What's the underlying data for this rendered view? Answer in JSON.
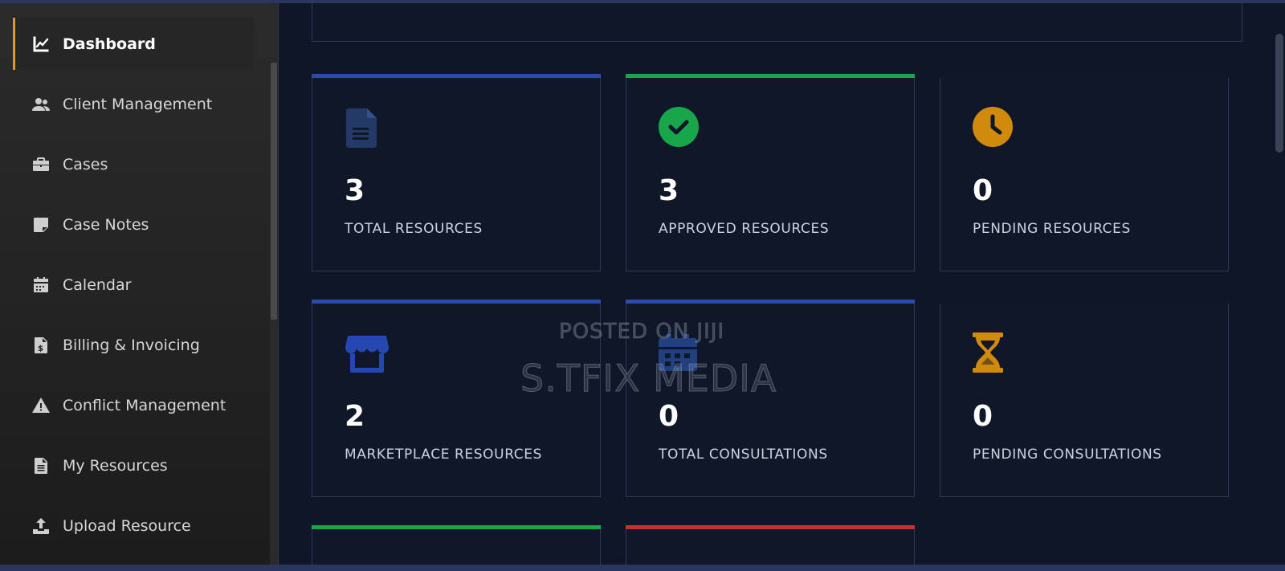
{
  "sidebar": {
    "items": [
      {
        "label": "Dashboard",
        "icon": "chart-line-icon",
        "active": true
      },
      {
        "label": "Client Management",
        "icon": "users-icon"
      },
      {
        "label": "Cases",
        "icon": "briefcase-icon"
      },
      {
        "label": "Case Notes",
        "icon": "sticky-note-icon"
      },
      {
        "label": "Calendar",
        "icon": "calendar-icon"
      },
      {
        "label": "Billing & Invoicing",
        "icon": "invoice-dollar-icon"
      },
      {
        "label": "Conflict Management",
        "icon": "warning-icon"
      },
      {
        "label": "My Resources",
        "icon": "file-lines-icon"
      },
      {
        "label": "Upload Resource",
        "icon": "upload-icon"
      }
    ]
  },
  "stats": [
    {
      "count": "3",
      "label": "TOTAL RESOURCES",
      "icon": "file-icon",
      "accent": "#2c4aa8"
    },
    {
      "count": "3",
      "label": "APPROVED RESOURCES",
      "icon": "check-circle-icon",
      "accent": "#18a64a"
    },
    {
      "count": "0",
      "label": "PENDING RESOURCES",
      "icon": "clock-icon",
      "accent": "#d18a0b"
    },
    {
      "count": "2",
      "label": "MARKETPLACE RESOURCES",
      "icon": "store-icon",
      "accent": "#2c4aa8"
    },
    {
      "count": "0",
      "label": "TOTAL CONSULTATIONS",
      "icon": "calendar-icon",
      "accent": "#2c4aa8"
    },
    {
      "count": "0",
      "label": "PENDING CONSULTATIONS",
      "icon": "hourglass-icon",
      "accent": "#d18a0b"
    }
  ],
  "partial_cards": [
    {
      "accent": "#18a64a"
    },
    {
      "accent": "#c8302c"
    }
  ],
  "watermark": {
    "line1": "POSTED ON JIJI",
    "line2": "S.TFIX MEDIA"
  }
}
